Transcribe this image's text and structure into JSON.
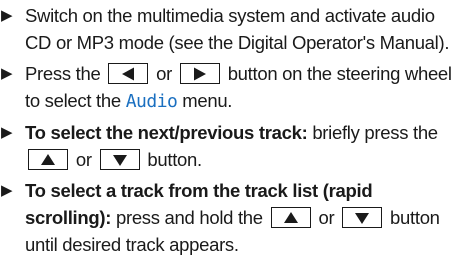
{
  "steps": [
    {
      "text": "Switch on the multimedia system and activate audio CD or MP3 mode (see the Digital Operator's Manual)."
    },
    {
      "part1": "Press the",
      "or": "or",
      "part2": "button on the steering wheel to select the",
      "display_word": "Audio",
      "part3": "menu.",
      "button_icons": [
        "arrow-left-icon",
        "arrow-right-icon"
      ]
    },
    {
      "bold": "To select the next/previous track:",
      "part1": "briefly press the",
      "or": "or",
      "part2": "button.",
      "button_icons": [
        "arrow-up-icon",
        "arrow-down-icon"
      ]
    },
    {
      "bold": "To select a track from the track list (rapid scrolling):",
      "part1": "press and hold the",
      "or": "or",
      "part2": "button until desired track appears.",
      "button_icons": [
        "arrow-up-icon",
        "arrow-down-icon"
      ]
    }
  ],
  "colors": {
    "text": "#1a1a1a",
    "display_word": "#1a6fc0"
  },
  "icons": {
    "bullet": "step-arrow-icon"
  }
}
